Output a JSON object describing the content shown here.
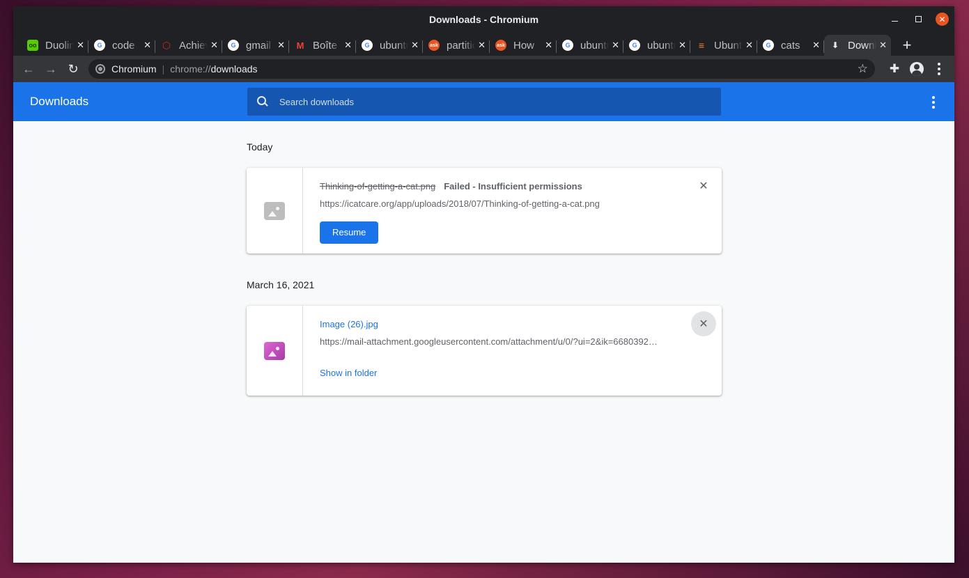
{
  "window": {
    "title": "Downloads - Chromium"
  },
  "tabs": [
    {
      "title": "Duolingo",
      "favicon": "duolingo-icon",
      "color": "#58cc02"
    },
    {
      "title": "code",
      "favicon": "google-icon",
      "color": "#ffffff"
    },
    {
      "title": "Achievements",
      "favicon": "achievement-icon",
      "color": "#c62828"
    },
    {
      "title": "gmail",
      "favicon": "google-icon",
      "color": "#ffffff"
    },
    {
      "title": "Boîte",
      "favicon": "gmail-icon",
      "color": "#ffffff"
    },
    {
      "title": "ubuntu",
      "favicon": "google-icon",
      "color": "#ffffff"
    },
    {
      "title": "partition",
      "favicon": "askubuntu-icon",
      "color": "#e95420"
    },
    {
      "title": "How",
      "favicon": "askubuntu-icon",
      "color": "#e95420"
    },
    {
      "title": "ubuntu",
      "favicon": "google-icon",
      "color": "#ffffff"
    },
    {
      "title": "ubuntu",
      "favicon": "google-icon",
      "color": "#ffffff"
    },
    {
      "title": "Ubuntu",
      "favicon": "stackoverflow-icon",
      "color": "#f48024"
    },
    {
      "title": "cats",
      "favicon": "google-icon",
      "color": "#ffffff"
    },
    {
      "title": "Downloads",
      "favicon": "download-icon",
      "color": "#e8eaed",
      "active": true
    }
  ],
  "toolbar": {
    "omnibox_host": "Chromium",
    "omnibox_scheme": "chrome://",
    "omnibox_path": "downloads"
  },
  "page": {
    "title": "Downloads",
    "search_placeholder": "Search downloads"
  },
  "sections": [
    {
      "date": "Today",
      "items": [
        {
          "filename": "Thinking-of-getting-a-cat.png",
          "status": "Failed - Insufficient permissions",
          "url": "https://icatcare.org/app/uploads/2018/07/Thinking-of-getting-a-cat.png",
          "action": "Resume"
        }
      ]
    },
    {
      "date": "March 16, 2021",
      "items": [
        {
          "filename": "Image (26).jpg",
          "url": "https://mail-attachment.googleusercontent.com/attachment/u/0/?ui=2&ik=6680392…",
          "action": "Show in folder"
        }
      ]
    }
  ],
  "colors": {
    "accent": "#1a73e8",
    "header": "#1a73e8",
    "ubuntu_orange": "#e95420"
  }
}
